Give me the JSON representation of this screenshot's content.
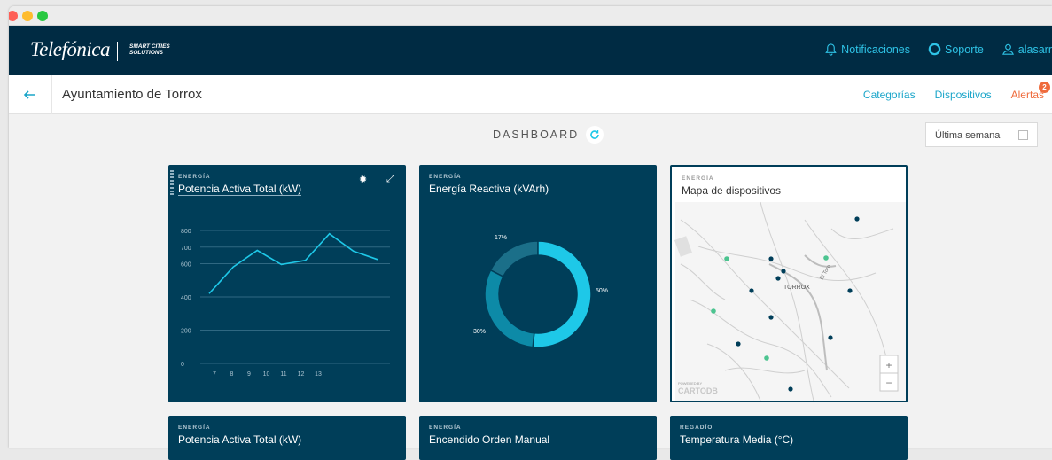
{
  "brand": {
    "name": "Telefónica",
    "sub_line1": "SMART CITIES",
    "sub_line2": "SOLUTIONS"
  },
  "topnav": {
    "notifications": "Notificaciones",
    "support": "Soporte",
    "user": "alasarr"
  },
  "subbar": {
    "title": "Ayuntamiento de Torrox",
    "links": [
      "Categorías",
      "Dispositivos"
    ],
    "alerts": "Alertas",
    "alerts_count": "2"
  },
  "dashboard": {
    "title": "DASHBOARD",
    "period": "Última semana"
  },
  "colors": {
    "navy": "#002b43",
    "card": "#003e59",
    "accent": "#1ec8e8",
    "donut_dark": "#1b6f89",
    "donut_mid": "#0d8aa7",
    "map_green": "#4cc490"
  },
  "cards": [
    {
      "category": "ENERGÍA",
      "title": "Potencia Activa Total (kW)"
    },
    {
      "category": "ENERGÍA",
      "title": "Energía Reactiva (kVArh)"
    },
    {
      "category": "ENERGÍA",
      "title": "Mapa de dispositivos"
    },
    {
      "category": "ENERGÍA",
      "title": "Potencia Activa Total (kW)"
    },
    {
      "category": "ENERGÍA",
      "title": "Encendido Orden Manual"
    },
    {
      "category": "REGADÍO",
      "title": "Temperatura Media (°C)"
    }
  ],
  "chart_data": [
    {
      "type": "line",
      "x": [
        7,
        8,
        9,
        10,
        11,
        12,
        13
      ],
      "series": [
        {
          "values": [
            420,
            580,
            680,
            595,
            620,
            780,
            675,
            625
          ]
        }
      ],
      "ylim": [
        0,
        800
      ],
      "yticks": [
        0,
        200,
        400,
        600,
        700,
        800
      ],
      "xticks": [
        7,
        8,
        9,
        10,
        11,
        12,
        13
      ],
      "grid": true
    },
    {
      "type": "pie",
      "labels": [
        "17%",
        "50%",
        "30%"
      ],
      "values": [
        17,
        50,
        30
      ]
    }
  ],
  "map": {
    "label": "TORROX",
    "river": "El Toro",
    "attribution_top": "POWERED BY",
    "attribution": "CARTODB",
    "zoom_in": "+",
    "zoom_out": "−"
  }
}
